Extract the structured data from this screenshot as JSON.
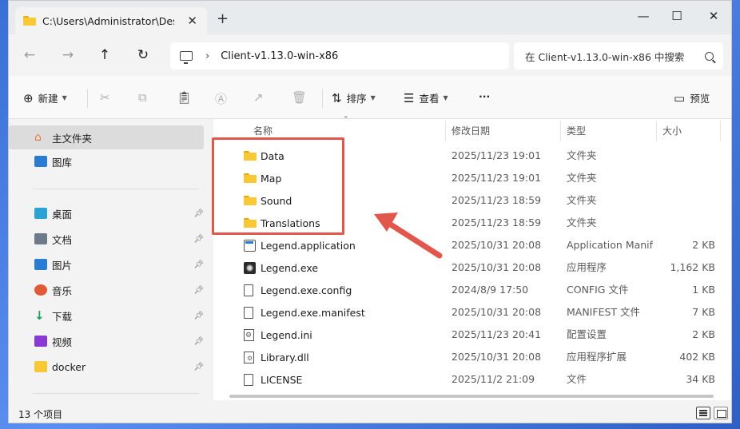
{
  "window": {
    "tab_title": "C:\\Users\\Administrator\\Desktop",
    "new_tab": "+",
    "tab_close": "✕",
    "minimize": "—",
    "maximize": "☐",
    "close": "✕"
  },
  "address": {
    "breadcrumb_sep": "›",
    "crumb": "Client-v1.13.0-win-x86",
    "search_placeholder": "在 Client-v1.13.0-win-x86 中搜索"
  },
  "toolbar": {
    "new_label": "新建",
    "sort_label": "排序",
    "view_label": "查看",
    "more_label": "···",
    "preview_label": "预览"
  },
  "sidebar": {
    "items": [
      {
        "label": "主文件夹",
        "icon": "home-icon",
        "color": "#e07b39"
      },
      {
        "label": "图库",
        "icon": "gallery-icon",
        "color": "#2a7bd4"
      },
      {
        "label": "桌面",
        "icon": "desktop-icon",
        "color": "#2aa3d4"
      },
      {
        "label": "文档",
        "icon": "documents-icon",
        "color": "#6c7a89"
      },
      {
        "label": "图片",
        "icon": "pictures-icon",
        "color": "#2a7bd4"
      },
      {
        "label": "音乐",
        "icon": "music-icon",
        "color": "#e05a3a"
      },
      {
        "label": "下载",
        "icon": "downloads-icon",
        "color": "#1e9e5a"
      },
      {
        "label": "视频",
        "icon": "videos-icon",
        "color": "#8a3ad4"
      },
      {
        "label": "docker",
        "icon": "folder-icon",
        "color": "#f8c935"
      }
    ]
  },
  "columns": {
    "name": "名称",
    "date": "修改日期",
    "type": "类型",
    "size": "大小"
  },
  "files": [
    {
      "name": "Data",
      "date": "2025/11/23 19:01",
      "type": "文件夹",
      "size": "",
      "icon": "folder-icon"
    },
    {
      "name": "Map",
      "date": "2025/11/23 19:01",
      "type": "文件夹",
      "size": "",
      "icon": "folder-icon"
    },
    {
      "name": "Sound",
      "date": "2025/11/23 18:59",
      "type": "文件夹",
      "size": "",
      "icon": "folder-icon"
    },
    {
      "name": "Translations",
      "date": "2025/11/23 18:59",
      "type": "文件夹",
      "size": "",
      "icon": "folder-icon"
    },
    {
      "name": "Legend.application",
      "date": "2025/10/31 20:08",
      "type": "Application Manifest",
      "size": "2 KB",
      "icon": "application-manifest-icon"
    },
    {
      "name": "Legend.exe",
      "date": "2025/10/31 20:08",
      "type": "应用程序",
      "size": "1,162 KB",
      "icon": "exe-icon"
    },
    {
      "name": "Legend.exe.config",
      "date": "2024/8/9 17:50",
      "type": "CONFIG 文件",
      "size": "1 KB",
      "icon": "file-icon"
    },
    {
      "name": "Legend.exe.manifest",
      "date": "2025/10/31 20:08",
      "type": "MANIFEST 文件",
      "size": "7 KB",
      "icon": "file-icon"
    },
    {
      "name": "Legend.ini",
      "date": "2025/11/23 20:41",
      "type": "配置设置",
      "size": "2 KB",
      "icon": "ini-icon"
    },
    {
      "name": "Library.dll",
      "date": "2025/10/31 20:08",
      "type": "应用程序扩展",
      "size": "402 KB",
      "icon": "dll-icon"
    },
    {
      "name": "LICENSE",
      "date": "2025/11/2 21:09",
      "type": "文件",
      "size": "34 KB",
      "icon": "file-icon"
    }
  ],
  "status": {
    "count": "13 个项目"
  },
  "colors": {
    "highlight": "#e2574c",
    "folder": "#f8c935"
  }
}
